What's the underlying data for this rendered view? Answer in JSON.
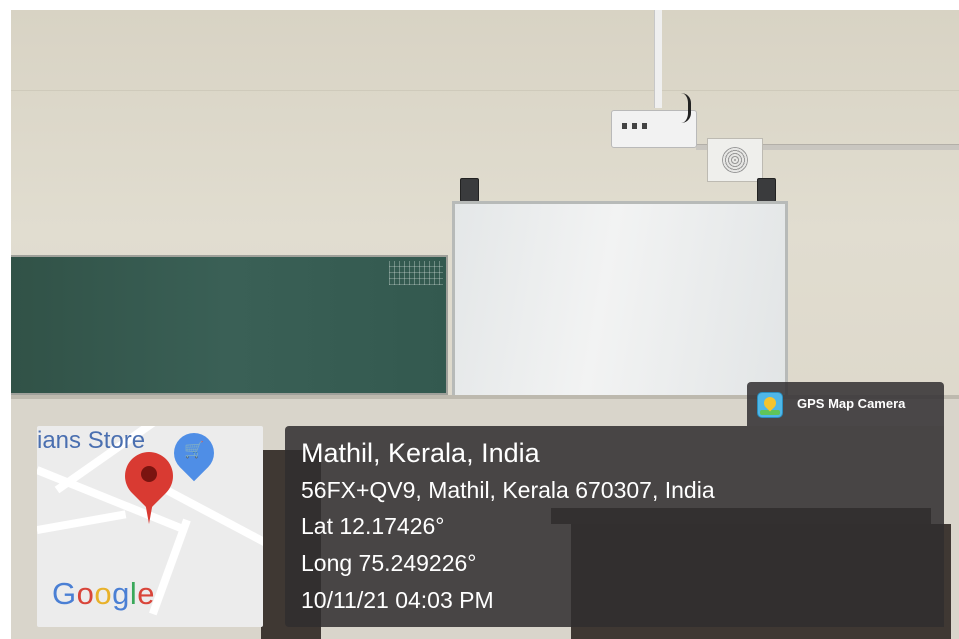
{
  "map": {
    "store_text": "ians Store",
    "cart_icon": "shopping-cart-icon",
    "pin_icon": "map-pin-icon",
    "logo_letters": [
      {
        "ch": "G",
        "color": "#4a7fd4"
      },
      {
        "ch": "o",
        "color": "#d9453a"
      },
      {
        "ch": "o",
        "color": "#e8b12a"
      },
      {
        "ch": "g",
        "color": "#4a7fd4"
      },
      {
        "ch": "l",
        "color": "#3aa85a"
      },
      {
        "ch": "e",
        "color": "#d9453a"
      }
    ]
  },
  "badge": {
    "icon": "gps-map-camera-icon",
    "label": "GPS Map Camera"
  },
  "info": {
    "title": "Mathil, Kerala, India",
    "address": "56FX+QV9, Mathil, Kerala 670307, India",
    "lat": "Lat 12.17426°",
    "long": "Long 75.249226°",
    "datetime": "10/11/21 04:03 PM"
  },
  "colors": {
    "panel_bg": "#302d2e",
    "pin_red": "#d93a32",
    "chalkboard": "#34574f"
  }
}
